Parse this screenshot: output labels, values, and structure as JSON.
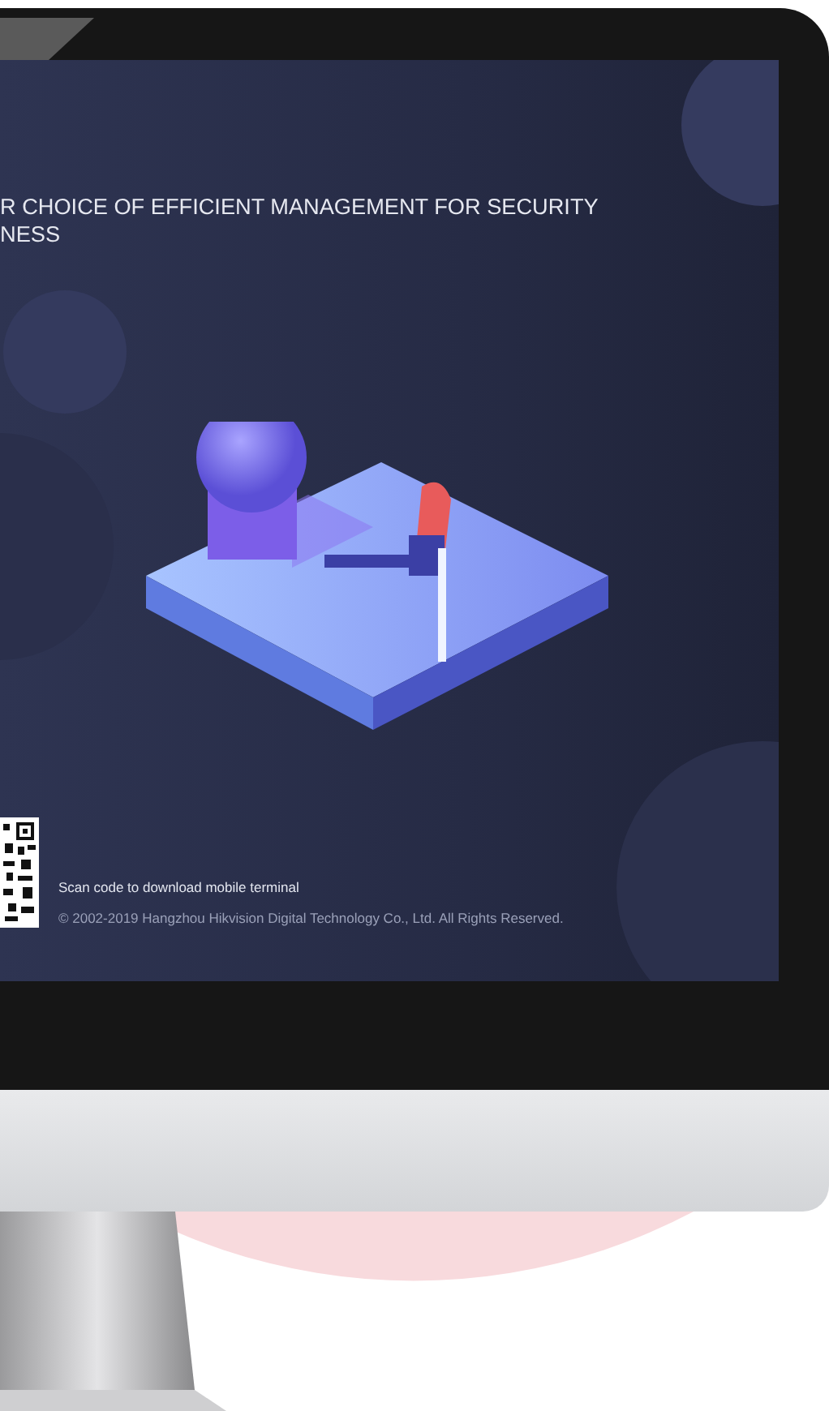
{
  "screen": {
    "headline_lines": [
      "R CHOICE OF EFFICIENT MANAGEMENT FOR SECURITY",
      "NESS"
    ],
    "footer": {
      "scan_hint": "Scan code to download mobile terminal",
      "copyright": "© 2002-2019 Hangzhou Hikvision Digital Technology Co., Ltd. All Rights Reserved."
    }
  }
}
